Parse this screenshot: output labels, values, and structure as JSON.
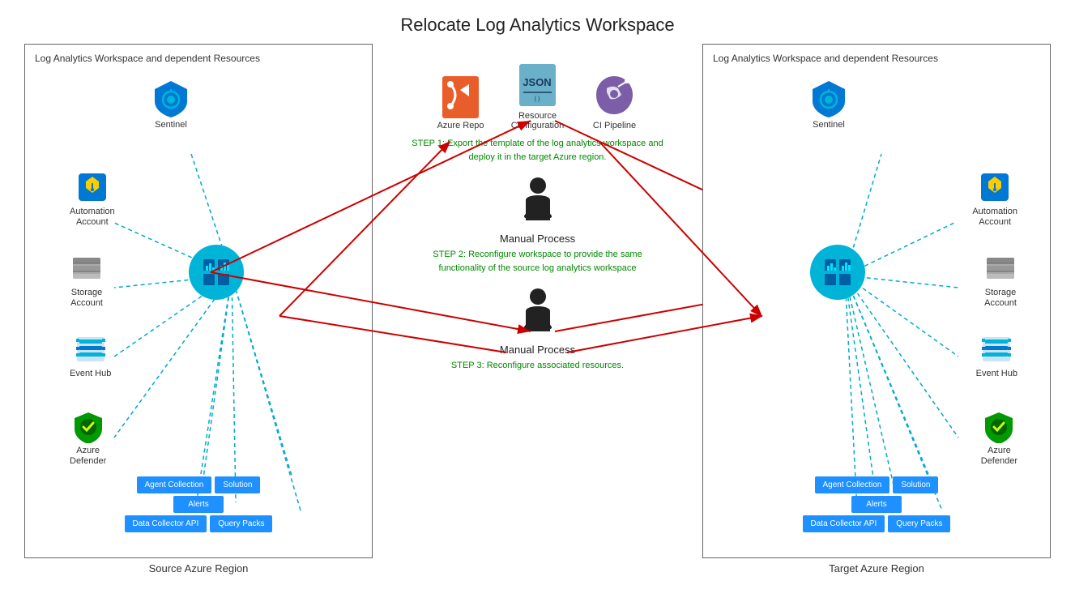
{
  "title": "Relocate Log Analytics Workspace",
  "left_box": {
    "label": "Log Analytics Workspace and dependent Resources",
    "sentinel": "Sentinel",
    "automation": "Automation\nAccount",
    "storage": "Storage\nAccount",
    "eventhub": "Event Hub",
    "defender": "Azure\nDefender",
    "data_boxes": {
      "row1": [
        "Agent Collection",
        "Solution"
      ],
      "row2": [
        "Alerts"
      ],
      "row3": [
        "Data Collector API",
        "Query Packs"
      ]
    },
    "region": "Source Azure Region"
  },
  "right_box": {
    "label": "Log Analytics Workspace and dependent Resources",
    "sentinel": "Sentinel",
    "automation": "Automation\nAccount",
    "storage": "Storage\nAccount",
    "eventhub": "Event Hub",
    "defender": "Azure\nDefender",
    "data_boxes": {
      "row1": [
        "Agent Collection",
        "Solution"
      ],
      "row2": [
        "Alerts"
      ],
      "row3": [
        "Data Collector API",
        "Query Packs"
      ]
    },
    "region": "Target Azure Region"
  },
  "middle": {
    "azure_repo": "Azure Repo",
    "resource_config": "Resource\nConfiguration",
    "ci_pipeline": "CI Pipeline",
    "step1_label": "Manual Process",
    "step1_text": "STEP 1: Export the template of the log analytics workspace and\ndeploy it in the target Azure region.",
    "step2_label": "Manual Process",
    "step2_text": "STEP 2: Reconfigure workspace to provide the same\nfunctionality of the source log analytics workspace",
    "step3_label": "Manual Process",
    "step3_text": "STEP 3: Reconfigure associated resources."
  },
  "colors": {
    "accent_blue": "#1e90ff",
    "dashed": "#00aacc",
    "red": "#cc0000",
    "green_text": "#008800",
    "sentinel_blue": "#0078d4",
    "box_border": "#666"
  }
}
